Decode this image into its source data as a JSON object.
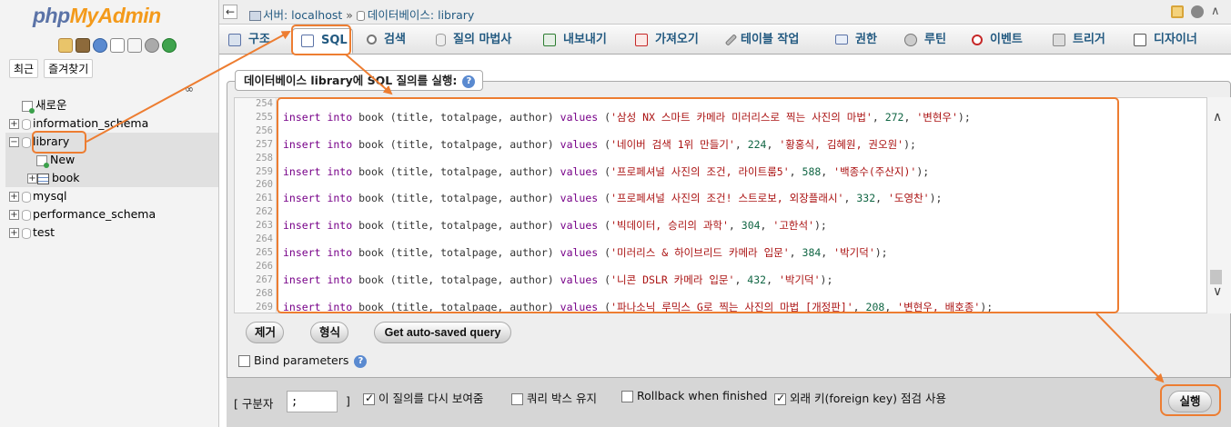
{
  "nav": {
    "logo_php": "php",
    "logo_admin": "MyAdmin",
    "icons": [
      "home-icon",
      "exit-icon",
      "info-icon",
      "docs-icon",
      "sql-doc-icon",
      "settings-icon",
      "reload-icon"
    ],
    "tab_recent": "최근",
    "tab_favorites": "즐겨찾기",
    "tree": [
      {
        "label": "새로운"
      },
      {
        "label": "information_schema"
      },
      {
        "label": "library"
      },
      {
        "label": "New"
      },
      {
        "label": "book"
      },
      {
        "label": "mysql"
      },
      {
        "label": "performance_schema"
      },
      {
        "label": "test"
      }
    ]
  },
  "topbar": {
    "server_label": "서버: localhost",
    "separator": "»",
    "db_label": "데이터베이스: library"
  },
  "tabs": [
    {
      "label": "구조"
    },
    {
      "label": "SQL"
    },
    {
      "label": "검색"
    },
    {
      "label": "질의 마법사"
    },
    {
      "label": "내보내기"
    },
    {
      "label": "가져오기"
    },
    {
      "label": "테이블 작업"
    },
    {
      "label": "권한"
    },
    {
      "label": "루틴"
    },
    {
      "label": "이벤트"
    },
    {
      "label": "트리거"
    },
    {
      "label": "디자이너"
    }
  ],
  "sql": {
    "legend": "데이터베이스 library에 SQL 질의를 실행:",
    "lines": [
      {
        "n": "254"
      },
      {
        "n": "255",
        "kw1": "insert into",
        "mid": " book (title, totalpage, author) ",
        "kw2": "values",
        "open": " (",
        "s1": "'삼성 NX 스마트 카메라 미러리스로 찍는 사진의 마법'",
        "c1": ", ",
        "num": "272",
        "c2": ", ",
        "s2": "'변현우'",
        "close": ");"
      },
      {
        "n": "256"
      },
      {
        "n": "257",
        "kw1": "insert into",
        "mid": " book (title, totalpage, author) ",
        "kw2": "values",
        "open": " (",
        "s1": "'네이버 검색 1위 만들기'",
        "c1": ", ",
        "num": "224",
        "c2": ", ",
        "s2": "'황홍식, 김혜원, 권오원'",
        "close": ");"
      },
      {
        "n": "258"
      },
      {
        "n": "259",
        "kw1": "insert into",
        "mid": " book (title, totalpage, author) ",
        "kw2": "values",
        "open": " (",
        "s1": "'프로페셔널 사진의 조건, 라이트룸5'",
        "c1": ", ",
        "num": "588",
        "c2": ", ",
        "s2": "'백종수(주산지)'",
        "close": ");"
      },
      {
        "n": "260"
      },
      {
        "n": "261",
        "kw1": "insert into",
        "mid": " book (title, totalpage, author) ",
        "kw2": "values",
        "open": " (",
        "s1": "'프로페셔널 사진의 조건! 스트로보, 외장플래시'",
        "c1": ", ",
        "num": "332",
        "c2": ", ",
        "s2": "'도영찬'",
        "close": ");"
      },
      {
        "n": "262"
      },
      {
        "n": "263",
        "kw1": "insert into",
        "mid": " book (title, totalpage, author) ",
        "kw2": "values",
        "open": " (",
        "s1": "'빅데이터, 승리의 과학'",
        "c1": ", ",
        "num": "304",
        "c2": ", ",
        "s2": "'고한석'",
        "close": ");"
      },
      {
        "n": "264"
      },
      {
        "n": "265",
        "kw1": "insert into",
        "mid": " book (title, totalpage, author) ",
        "kw2": "values",
        "open": " (",
        "s1": "'미러리스 & 하이브리드 카메라 입문'",
        "c1": ", ",
        "num": "384",
        "c2": ", ",
        "s2": "'박기덕'",
        "close": ");"
      },
      {
        "n": "266"
      },
      {
        "n": "267",
        "kw1": "insert into",
        "mid": " book (title, totalpage, author) ",
        "kw2": "values",
        "open": " (",
        "s1": "'니콘 DSLR 카메라 입문'",
        "c1": ", ",
        "num": "432",
        "c2": ", ",
        "s2": "'박기덕'",
        "close": ");"
      },
      {
        "n": "268"
      },
      {
        "n": "269",
        "kw1": "insert into",
        "mid": " book (title, totalpage, author) ",
        "kw2": "values",
        "open": " (",
        "s1": "'파나소닉 루믹스 G로 찍는 사진의 마법 [개정판]'",
        "c1": ", ",
        "num": "208",
        "c2": ", ",
        "s2": "'변현우, 배호종'",
        "close": ");"
      }
    ],
    "btn_clear": "제거",
    "btn_format": "형식",
    "btn_autosaved": "Get auto-saved query",
    "bind_params": "Bind parameters"
  },
  "footer": {
    "delimiter_open": "[ 구분자",
    "delimiter_value": ";",
    "delimiter_close": "]",
    "opt_show_again": "이 질의를 다시 보여줌",
    "opt_show_again_checked": true,
    "opt_retain_box": "쿼리 박스 유지",
    "opt_retain_box_checked": false,
    "opt_rollback": "Rollback when finished",
    "opt_rollback_checked": false,
    "opt_fk": "외래 키(foreign key) 점검 사용",
    "opt_fk_checked": true,
    "btn_go": "실행"
  },
  "annotation_color": "#ed7d31"
}
